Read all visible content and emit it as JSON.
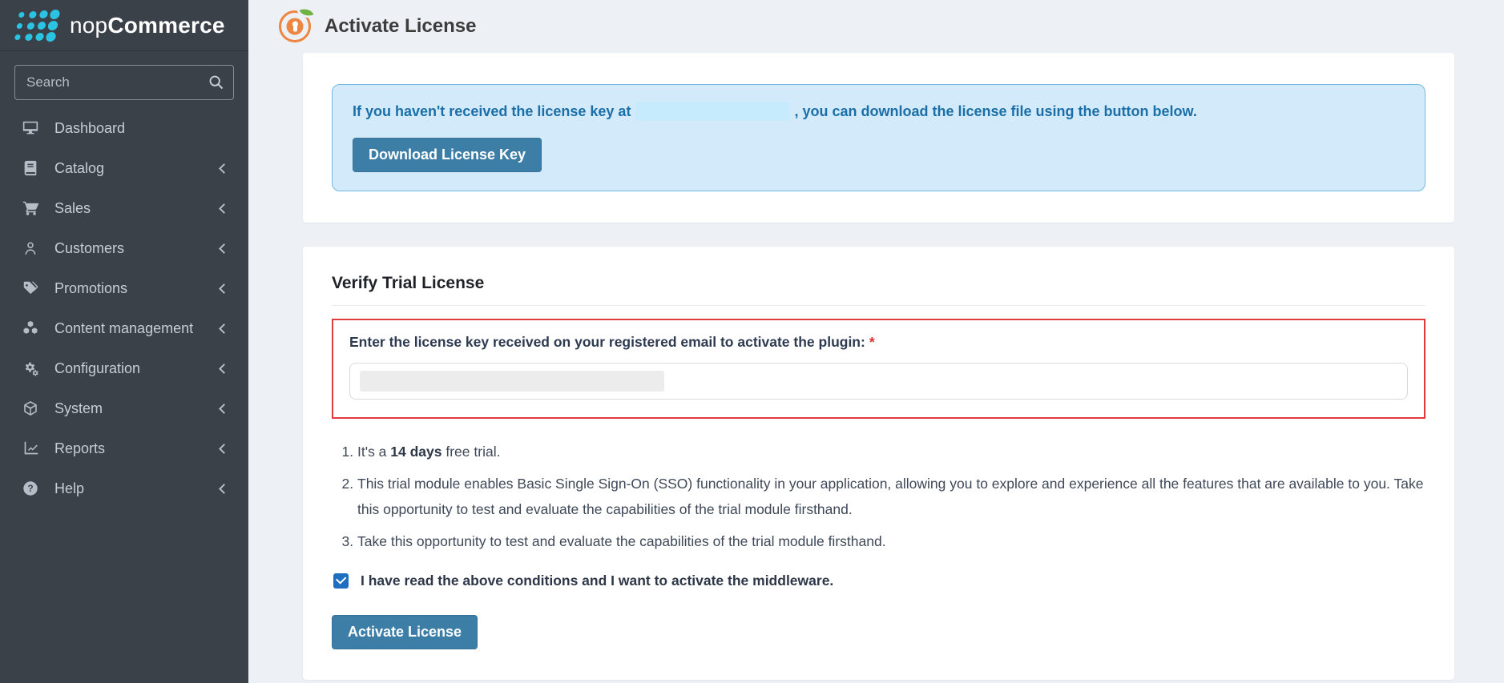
{
  "brand": {
    "name_regular": "nop",
    "name_bold": "Commerce",
    "logo_icon": "dot-grid-logo",
    "dot_color": "#2bc3e4"
  },
  "sidebar": {
    "background_color": "#3a4149",
    "search_placeholder": "Search",
    "search_icon": "search-icon",
    "items": [
      {
        "label": "Dashboard",
        "icon": "dashboard-icon",
        "has_chevron": false
      },
      {
        "label": "Catalog",
        "icon": "book-icon",
        "has_chevron": true
      },
      {
        "label": "Sales",
        "icon": "cart-icon",
        "has_chevron": true
      },
      {
        "label": "Customers",
        "icon": "user-icon",
        "has_chevron": true
      },
      {
        "label": "Promotions",
        "icon": "tags-icon",
        "has_chevron": true
      },
      {
        "label": "Content management",
        "icon": "cubes-icon",
        "has_chevron": true
      },
      {
        "label": "Configuration",
        "icon": "gears-icon",
        "has_chevron": true
      },
      {
        "label": "System",
        "icon": "cube-icon",
        "has_chevron": true
      },
      {
        "label": "Reports",
        "icon": "chart-line-icon",
        "has_chevron": true
      },
      {
        "label": "Help",
        "icon": "question-circle-icon",
        "has_chevron": true
      }
    ]
  },
  "header": {
    "title": "Activate License",
    "icon": "orange-keyhole-icon"
  },
  "download_panel": {
    "alert_text_part1": "If you haven't received the license key at",
    "alert_text_part2": ", you can ",
    "alert_text_bold": "download the license file",
    "alert_text_part3": " using the button below.",
    "alert_bg": "#d3eafa",
    "alert_text_color": "#1b6fa8",
    "button_label": "Download License Key",
    "button_color": "#3d7ea6"
  },
  "verify_panel": {
    "heading": "Verify Trial License",
    "input_label": "Enter the license key received on your registered email to activate the plugin:",
    "required_marker": "*",
    "highlight_border_color": "#e23b3b",
    "notes": [
      {
        "prefix": "It's a ",
        "bold": "14 days",
        "suffix": " free trial."
      },
      {
        "prefix": "This trial module enables Basic Single Sign-On (SSO) functionality in your application, allowing you to explore and experience all the features that are available to you. Take this opportunity to test and evaluate the capabilities of the trial module firsthand.",
        "bold": "",
        "suffix": ""
      },
      {
        "prefix": "Take this opportunity to test and evaluate the capabilities of the trial module firsthand.",
        "bold": "",
        "suffix": ""
      }
    ],
    "checkbox_checked": true,
    "checkbox_color": "#1f6fc0",
    "checkbox_label": "I have read the above conditions and I want to activate the middleware.",
    "button_label": "Activate License",
    "button_color": "#3d7ea6"
  }
}
